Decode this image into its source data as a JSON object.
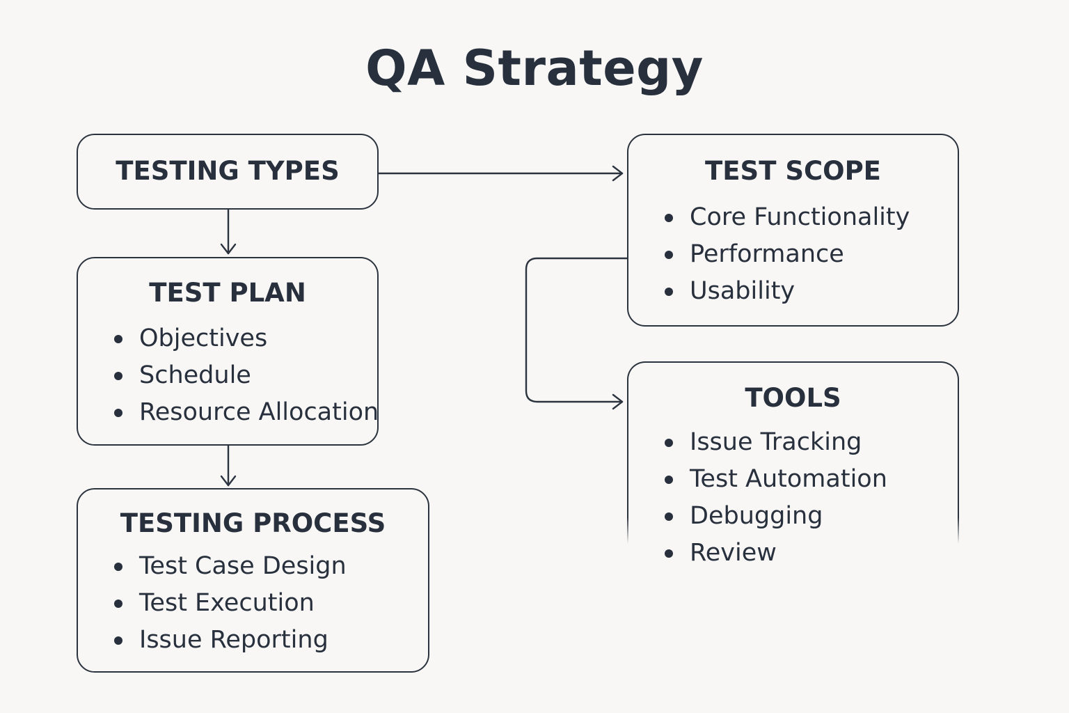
{
  "title": "QA Strategy",
  "boxes": {
    "testing_types": {
      "title": "TESTING TYPES",
      "items": []
    },
    "test_plan": {
      "title": "TEST PLAN",
      "items": [
        "Objectives",
        "Schedule",
        "Resource Allocation"
      ]
    },
    "testing_process": {
      "title": "TESTING PROCESS",
      "items": [
        "Test Case Design",
        "Test Execution",
        "Issue Reporting"
      ]
    },
    "test_scope": {
      "title": "TEST SCOPE",
      "items": [
        "Core Functionality",
        "Performance",
        "Usability"
      ]
    },
    "tools": {
      "title": "TOOLS",
      "items": [
        "Issue Tracking",
        "Test Automation",
        "Debugging",
        "Review"
      ]
    }
  },
  "connections": [
    {
      "from": "TESTING TYPES",
      "to": "TEST SCOPE"
    },
    {
      "from": "TESTING TYPES",
      "to": "TEST PLAN"
    },
    {
      "from": "TEST PLAN",
      "to": "TESTING PROCESS"
    },
    {
      "from": "TEST SCOPE",
      "to": "TOOLS"
    }
  ],
  "colors": {
    "background": "#f8f7f5",
    "stroke": "#2b333e",
    "text": "#27303c"
  }
}
